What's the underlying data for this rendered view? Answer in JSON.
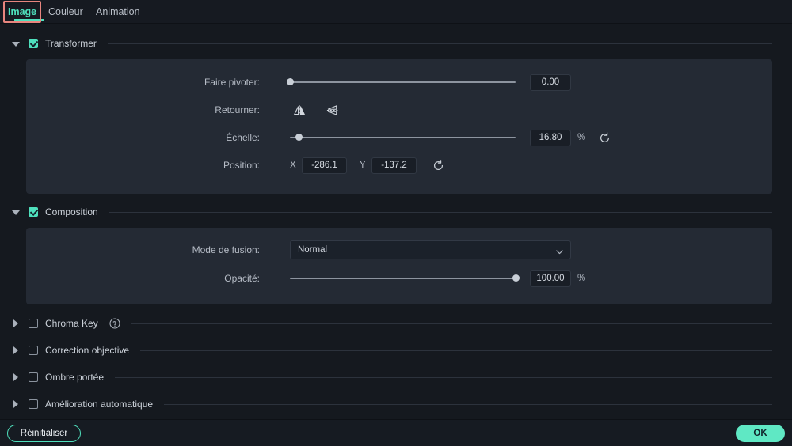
{
  "tabs": [
    {
      "label": "Image",
      "active": true
    },
    {
      "label": "Couleur",
      "active": false
    },
    {
      "label": "Animation",
      "active": false
    }
  ],
  "sections": {
    "transformer": {
      "label": "Transformer",
      "rotate": {
        "label": "Faire pivoter:",
        "value": "0.00",
        "percent": 0
      },
      "flip": {
        "label": "Retourner:",
        "horizontal_icon": "flip-horizontal-icon",
        "vertical_icon": "flip-vertical-icon"
      },
      "scale": {
        "label": "Échelle:",
        "value": "16.80",
        "unit": "%",
        "percent": 4,
        "reset_icon": "reset-icon"
      },
      "position": {
        "label": "Position:",
        "x_axis": "X",
        "x_value": "-286.1",
        "y_axis": "Y",
        "y_value": "-137.2",
        "reset_icon": "reset-icon"
      }
    },
    "composition": {
      "label": "Composition",
      "blend": {
        "label": "Mode de fusion:",
        "value": "Normal"
      },
      "opacity": {
        "label": "Opacité:",
        "value": "100.00",
        "unit": "%",
        "percent": 100
      }
    },
    "chroma_key": {
      "label": "Chroma Key",
      "help_icon": "help-circle-icon"
    },
    "lens_correction": {
      "label": "Correction objective"
    },
    "drop_shadow": {
      "label": "Ombre portée"
    },
    "auto_enhance": {
      "label": "Amélioration automatique"
    }
  },
  "footer": {
    "reset_label": "Réinitialiser",
    "ok_label": "OK"
  },
  "colors": {
    "accent": "#4fe0bd",
    "ok_button": "#5fe8c4",
    "annotation": "#e8857e",
    "panel": "#242a34",
    "background": "#15191f"
  }
}
